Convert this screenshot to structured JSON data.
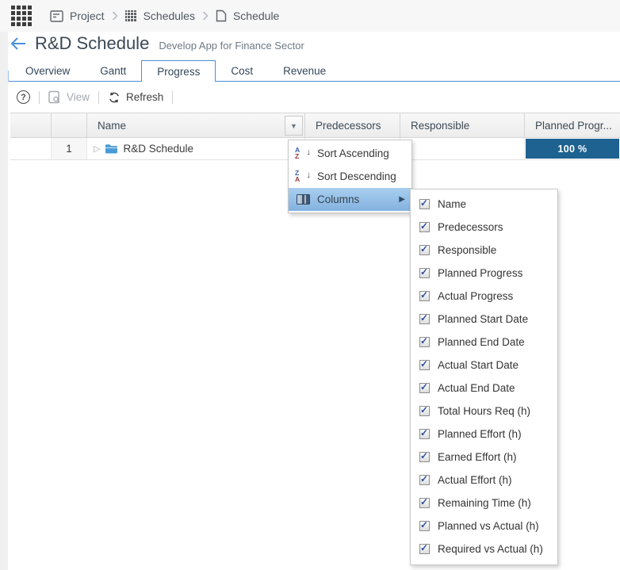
{
  "topbar": {
    "breadcrumb": [
      {
        "label": "Project",
        "icon": "project-icon"
      },
      {
        "label": "Schedules",
        "icon": "schedules-icon"
      },
      {
        "label": "Schedule",
        "icon": "schedule-icon"
      }
    ]
  },
  "header": {
    "title": "R&D Schedule",
    "subtitle": "Develop App for Finance Sector"
  },
  "tabs": [
    {
      "label": "Overview",
      "active": false
    },
    {
      "label": "Gantt",
      "active": false
    },
    {
      "label": "Progress",
      "active": true
    },
    {
      "label": "Cost",
      "active": false
    },
    {
      "label": "Revenue",
      "active": false
    }
  ],
  "toolbar": {
    "help": "?",
    "view_label": "View",
    "view_enabled": false,
    "refresh_label": "Refresh"
  },
  "table": {
    "columns": [
      "Name",
      "Predecessors",
      "Responsible",
      "Planned Progr..."
    ],
    "rows": [
      {
        "num": "1",
        "name": "R&D Schedule",
        "predecessors": "",
        "responsible": "",
        "planned_progress_label": "100 %",
        "planned_progress_value": 100
      }
    ]
  },
  "context_menu": {
    "items": [
      {
        "label": "Sort Ascending",
        "icon": "sort-ascending-icon",
        "highlighted": false
      },
      {
        "label": "Sort Descending",
        "icon": "sort-descending-icon",
        "highlighted": false
      },
      {
        "label": "Columns",
        "icon": "columns-icon",
        "highlighted": true,
        "has_submenu": true
      }
    ],
    "sort_asc_top": "A",
    "sort_asc_bottom": "Z",
    "sort_desc_top": "Z",
    "sort_desc_bottom": "A"
  },
  "columns_submenu": {
    "all_checked": true,
    "items": [
      "Name",
      "Predecessors",
      "Responsible",
      "Planned Progress",
      "Actual Progress",
      "Planned Start Date",
      "Planned End Date",
      "Actual Start Date",
      "Actual End Date",
      "Total Hours Req (h)",
      "Planned Effort (h)",
      "Earned Effort (h)",
      "Actual Effort (h)",
      "Remaining Time (h)",
      "Planned vs Actual (h)",
      "Required vs Actual (h)"
    ]
  },
  "colors": {
    "accent": "#4a90d9",
    "progress_bar": "#1d6291",
    "menu_highlight_top": "#a9ceef",
    "menu_highlight_bottom": "#83b2df",
    "folder": "#4a9bd5"
  }
}
